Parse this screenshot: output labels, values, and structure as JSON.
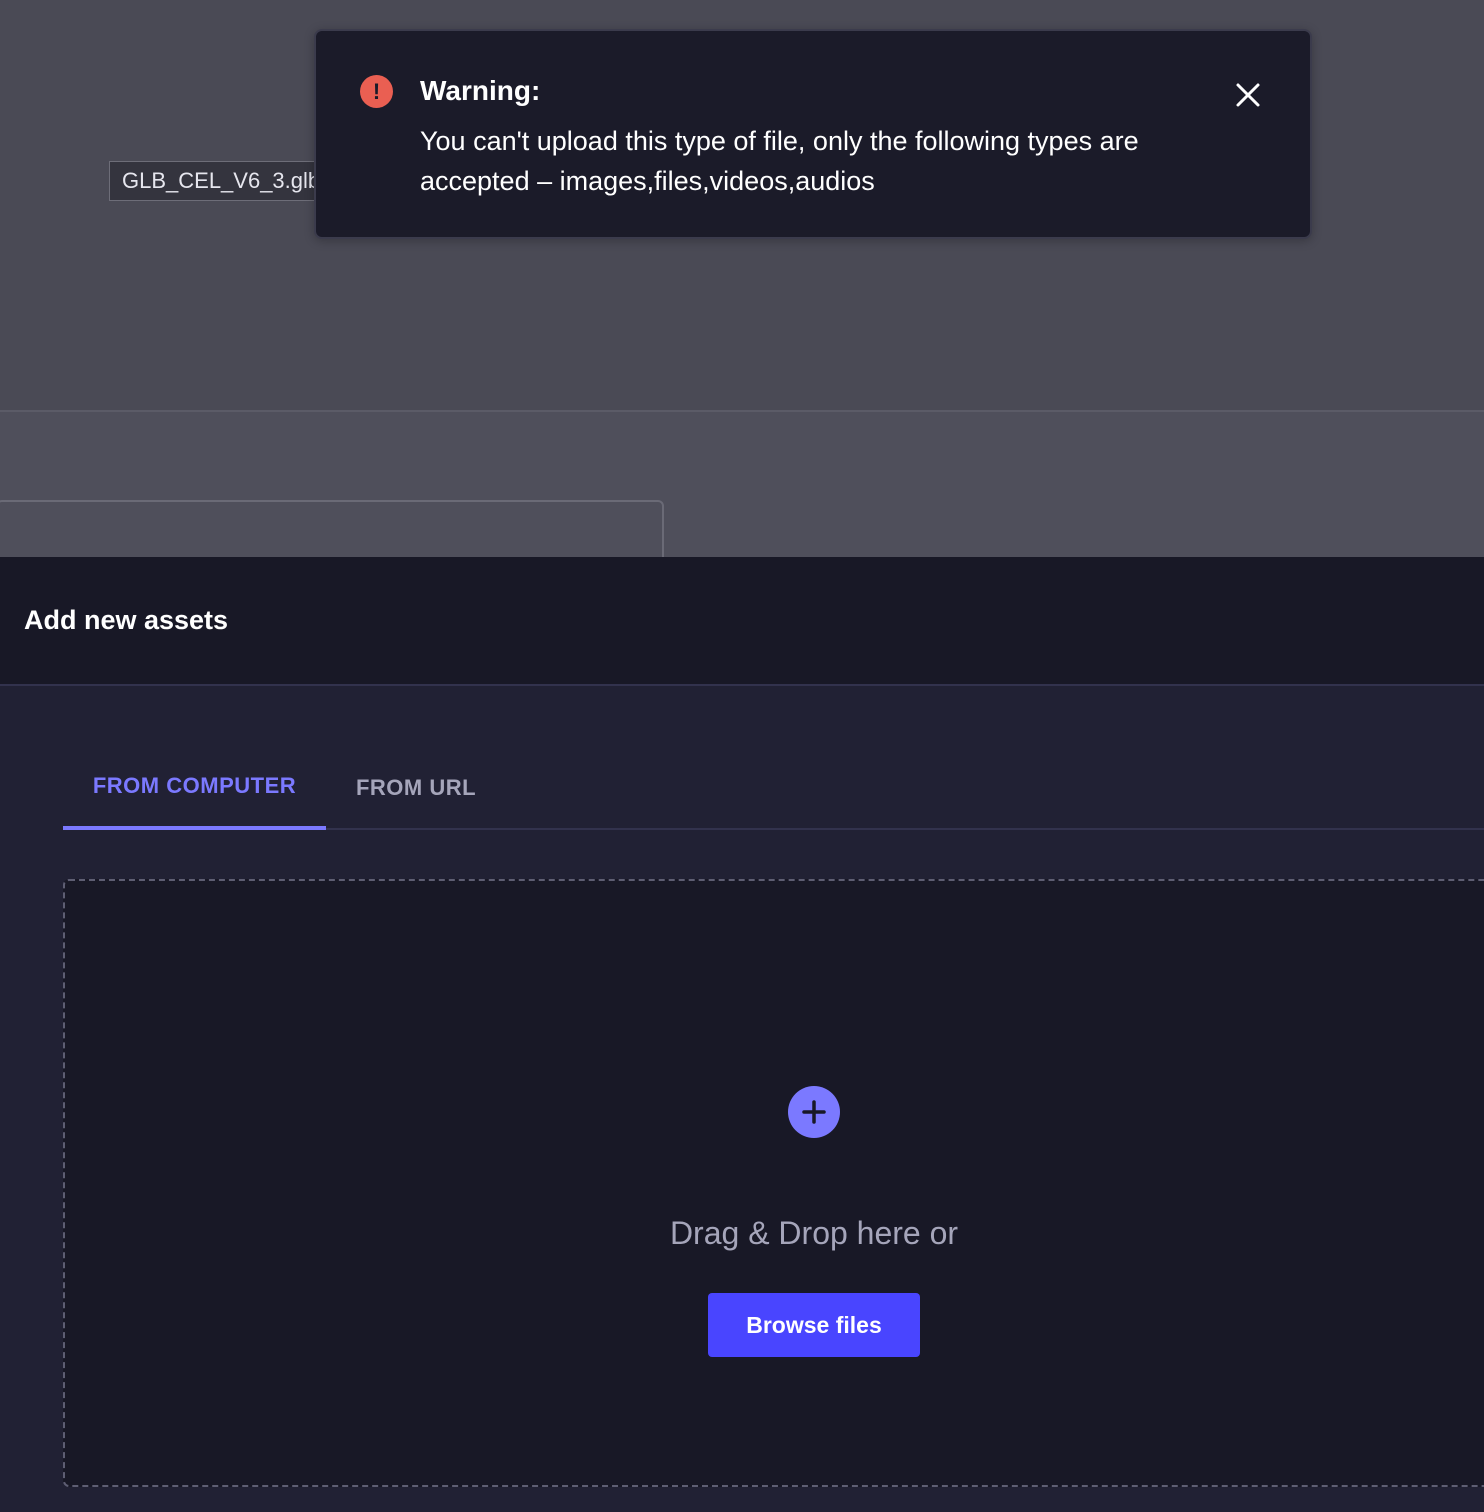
{
  "drag_ghost": {
    "filename": "GLB_CEL_V6_3.glb"
  },
  "toast": {
    "icon": "exclamation-circle-icon",
    "title": "Warning:",
    "message": "You can't upload this type of file, only the following types are accepted – images,files,videos,audios",
    "close_icon": "close-icon",
    "colors": {
      "icon": "#ea5f52",
      "background": "#1b1b29"
    }
  },
  "modal": {
    "title": "Add new assets",
    "tabs": [
      {
        "label": "FROM COMPUTER",
        "active": true
      },
      {
        "label": "FROM URL",
        "active": false
      }
    ],
    "dropzone": {
      "icon": "plus-circle-icon",
      "text": "Drag & Drop here or",
      "button_label": "Browse files"
    }
  },
  "colors": {
    "accent": "#7b79ff",
    "primary_button": "#4945ff",
    "modal_header": "#181826",
    "modal_body": "#212134"
  }
}
